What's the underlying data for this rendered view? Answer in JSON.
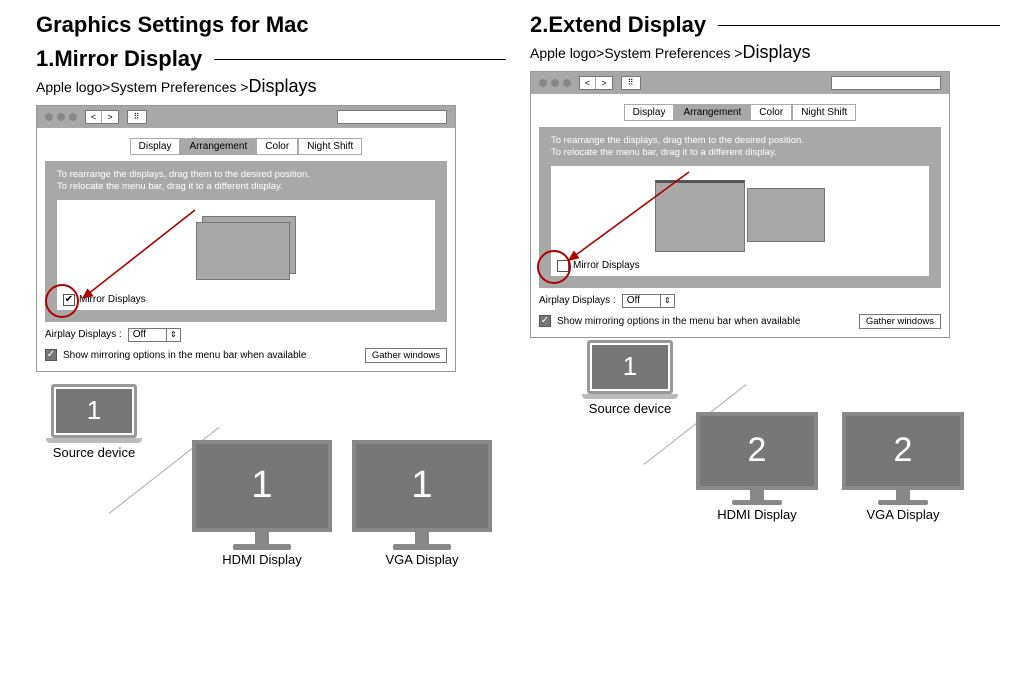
{
  "title": "Graphics Settings for Mac",
  "sections": {
    "mirror": {
      "title": "1.Mirror Display",
      "breadcrumb_prefix": "Apple logo>System Preferences >",
      "breadcrumb_last": "Displays",
      "tabs": [
        "Display",
        "Arrangement",
        "Color",
        "Night Shift"
      ],
      "active_tab": "Arrangement",
      "hint_line1": "To rearrange the displays, drag them to the desired position.",
      "hint_line2": "To relocate the menu bar, drag it to a different display.",
      "mirror_checkbox_label": "Mirror Displays",
      "mirror_checked": true,
      "airplay_label": "Airplay Displays :",
      "airplay_value": "Off",
      "show_mirroring_label": "Show mirroring options in the menu bar when available",
      "show_mirroring_checked": true,
      "gather_label": "Gather windows",
      "source_label": "Source device",
      "source_num": "1",
      "hdmi_label": "HDMI Display",
      "hdmi_num": "1",
      "vga_label": "VGA Display",
      "vga_num": "1"
    },
    "extend": {
      "title": "2.Extend Display",
      "breadcrumb_prefix": "Apple logo>System Preferences >",
      "breadcrumb_last": "Displays",
      "tabs": [
        "Display",
        "Arrangement",
        "Color",
        "Night Shift"
      ],
      "active_tab": "Arrangement",
      "hint_line1": "To rearrange the displays, drag them to the desired position.",
      "hint_line2": "To relocate the menu bar, drag it to a different display.",
      "mirror_checkbox_label": "Mirror Displays",
      "mirror_checked": false,
      "airplay_label": "Airplay Displays :",
      "airplay_value": "Off",
      "show_mirroring_label": "Show mirroring options in the menu bar when available",
      "show_mirroring_checked": true,
      "gather_label": "Gather windows",
      "source_label": "Source device",
      "source_num": "1",
      "hdmi_label": "HDMI Display",
      "hdmi_num": "2",
      "vga_label": "VGA Display",
      "vga_num": "2"
    }
  },
  "icons": {
    "check": "✓",
    "checksm": "✔",
    "caret": "⇕",
    "nav_back": "<",
    "nav_fwd": ">",
    "grid": "⠿"
  }
}
